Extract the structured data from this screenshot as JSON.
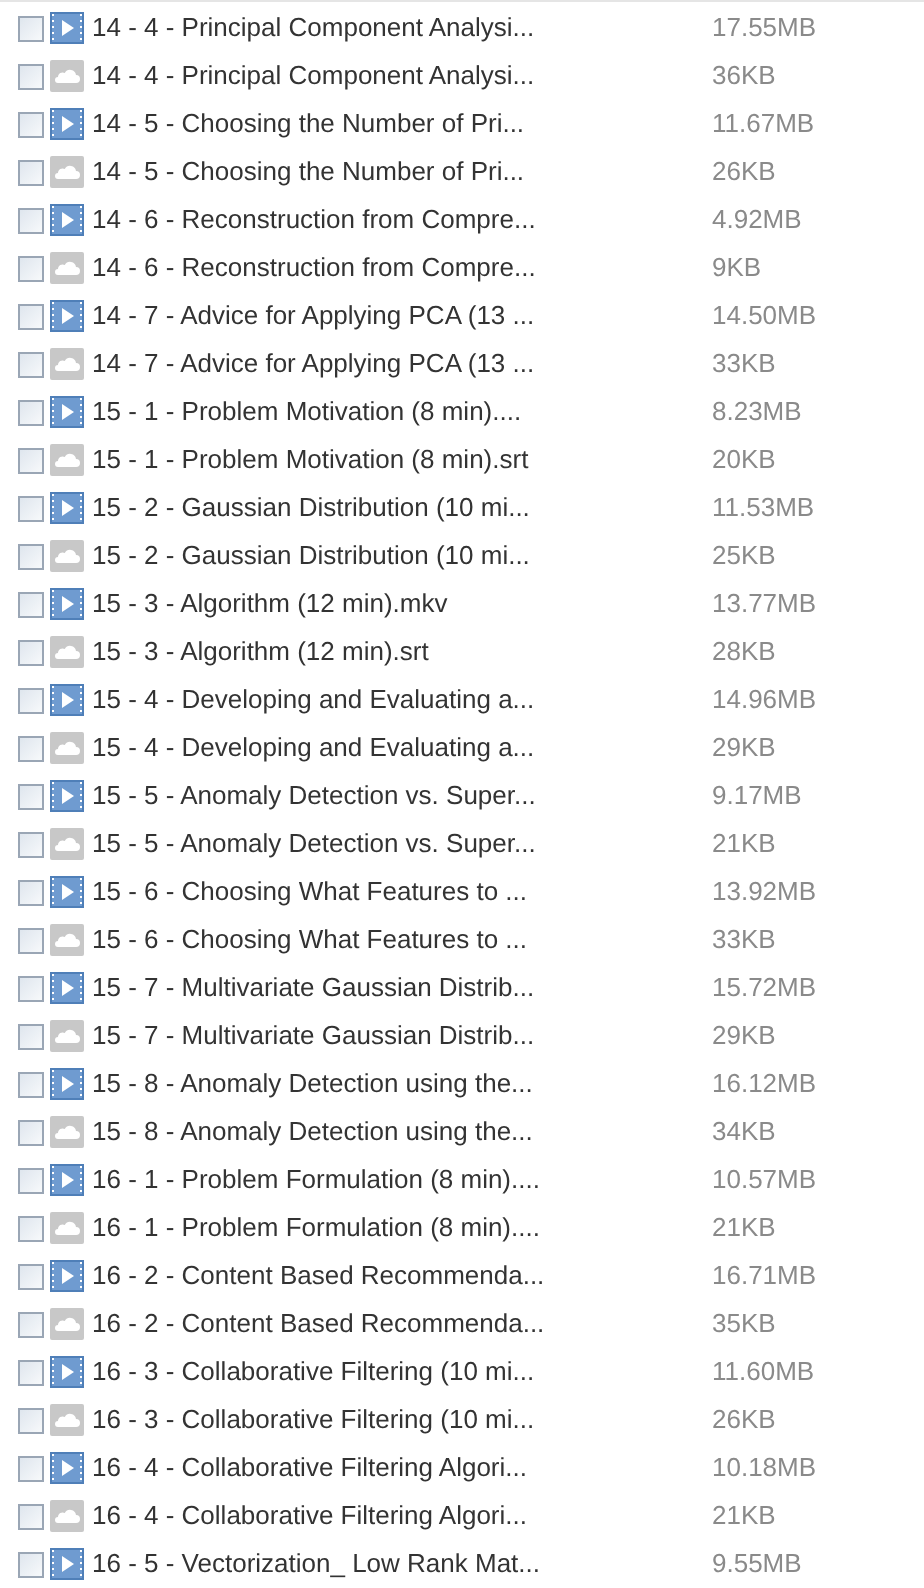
{
  "files": [
    {
      "kind": "video",
      "checked": false,
      "name": "14 - 4 - Principal Component Analysi...",
      "size": "17.55MB"
    },
    {
      "kind": "subtitle",
      "checked": false,
      "name": "14 - 4 - Principal Component Analysi...",
      "size": "36KB"
    },
    {
      "kind": "video",
      "checked": false,
      "name": "14 - 5 - Choosing the Number of Pri...",
      "size": "11.67MB"
    },
    {
      "kind": "subtitle",
      "checked": false,
      "name": "14 - 5 - Choosing the Number of Pri...",
      "size": "26KB"
    },
    {
      "kind": "video",
      "checked": false,
      "name": "14 - 6 - Reconstruction from Compre...",
      "size": "4.92MB"
    },
    {
      "kind": "subtitle",
      "checked": false,
      "name": "14 - 6 - Reconstruction from Compre...",
      "size": "9KB"
    },
    {
      "kind": "video",
      "checked": false,
      "name": "14 - 7 - Advice for Applying PCA (13 ...",
      "size": "14.50MB"
    },
    {
      "kind": "subtitle",
      "checked": false,
      "name": "14 - 7 - Advice for Applying PCA (13 ...",
      "size": "33KB"
    },
    {
      "kind": "video",
      "checked": false,
      "name": "15 - 1 - Problem Motivation (8 min)....",
      "size": "8.23MB"
    },
    {
      "kind": "subtitle",
      "checked": false,
      "name": "15 - 1 - Problem Motivation (8 min).srt",
      "size": "20KB"
    },
    {
      "kind": "video",
      "checked": false,
      "name": "15 - 2 - Gaussian Distribution (10 mi...",
      "size": "11.53MB"
    },
    {
      "kind": "subtitle",
      "checked": false,
      "name": "15 - 2 - Gaussian Distribution (10 mi...",
      "size": "25KB"
    },
    {
      "kind": "video",
      "checked": false,
      "name": "15 - 3 - Algorithm (12 min).mkv",
      "size": "13.77MB"
    },
    {
      "kind": "subtitle",
      "checked": false,
      "name": "15 - 3 - Algorithm (12 min).srt",
      "size": "28KB"
    },
    {
      "kind": "video",
      "checked": false,
      "name": "15 - 4 - Developing and Evaluating a...",
      "size": "14.96MB"
    },
    {
      "kind": "subtitle",
      "checked": false,
      "name": "15 - 4 - Developing and Evaluating a...",
      "size": "29KB"
    },
    {
      "kind": "video",
      "checked": false,
      "name": "15 - 5 - Anomaly Detection vs. Super...",
      "size": "9.17MB"
    },
    {
      "kind": "subtitle",
      "checked": false,
      "name": "15 - 5 - Anomaly Detection vs. Super...",
      "size": "21KB"
    },
    {
      "kind": "video",
      "checked": false,
      "name": "15 - 6 - Choosing What Features to ...",
      "size": "13.92MB"
    },
    {
      "kind": "subtitle",
      "checked": false,
      "name": "15 - 6 - Choosing What Features to ...",
      "size": "33KB"
    },
    {
      "kind": "video",
      "checked": false,
      "name": "15 - 7 - Multivariate Gaussian Distrib...",
      "size": "15.72MB"
    },
    {
      "kind": "subtitle",
      "checked": false,
      "name": "15 - 7 - Multivariate Gaussian Distrib...",
      "size": "29KB"
    },
    {
      "kind": "video",
      "checked": false,
      "name": "15 - 8 - Anomaly Detection using the...",
      "size": "16.12MB"
    },
    {
      "kind": "subtitle",
      "checked": false,
      "name": "15 - 8 - Anomaly Detection using the...",
      "size": "34KB"
    },
    {
      "kind": "video",
      "checked": false,
      "name": "16 - 1 - Problem Formulation (8 min)....",
      "size": "10.57MB"
    },
    {
      "kind": "subtitle",
      "checked": false,
      "name": "16 - 1 - Problem Formulation (8 min)....",
      "size": "21KB"
    },
    {
      "kind": "video",
      "checked": false,
      "name": "16 - 2 - Content Based Recommenda...",
      "size": "16.71MB"
    },
    {
      "kind": "subtitle",
      "checked": false,
      "name": "16 - 2 - Content Based Recommenda...",
      "size": "35KB"
    },
    {
      "kind": "video",
      "checked": false,
      "name": "16 - 3 - Collaborative Filtering (10 mi...",
      "size": "11.60MB"
    },
    {
      "kind": "subtitle",
      "checked": false,
      "name": "16 - 3 - Collaborative Filtering (10 mi...",
      "size": "26KB"
    },
    {
      "kind": "video",
      "checked": false,
      "name": "16 - 4 - Collaborative Filtering Algori...",
      "size": "10.18MB"
    },
    {
      "kind": "subtitle",
      "checked": false,
      "name": "16 - 4 - Collaborative Filtering Algori...",
      "size": "21KB"
    },
    {
      "kind": "video",
      "checked": false,
      "name": "16 - 5 - Vectorization_ Low Rank Mat...",
      "size": "9.55MB"
    }
  ]
}
